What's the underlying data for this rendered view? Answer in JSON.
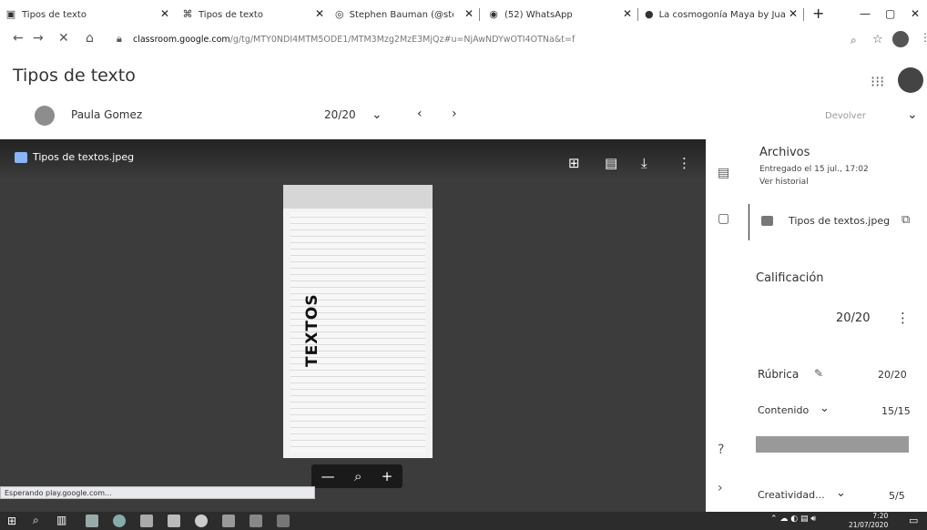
{
  "browser": {
    "tabs": [
      {
        "label": "Tipos de texto",
        "icon": "image-icon"
      },
      {
        "label": "Tipos de texto",
        "icon": "classroom-icon"
      },
      {
        "label": "Stephen Bauman (@stephen",
        "icon": "instagram-icon"
      },
      {
        "label": "(52) WhatsApp",
        "icon": "whatsapp-icon"
      },
      {
        "label": "La cosmogonía Maya by Juan",
        "icon": "prezi-icon"
      }
    ],
    "new_tab": "+",
    "url_host": "classroom.google.com",
    "url_path": "/g/tg/MTY0NDI4MTM5ODE1/MTM3Mzg2MzE3MjQz#u=NjAwNDYwOTI4OTNa&t=f",
    "window_controls": [
      "—",
      "▢",
      "✕"
    ]
  },
  "page": {
    "title": "Tipos de texto",
    "student_name": "Paula Gomez",
    "grade": "20/20",
    "status": "Devolver"
  },
  "viewer": {
    "file_name": "Tipos de textos.jpeg",
    "doc_word": "TEXTOS",
    "zoom_minus": "—",
    "zoom_plus": "+"
  },
  "status_link": "Esperando play.google.com...",
  "panel": {
    "files_heading": "Archivos",
    "delivered": "Entregado el 15 jul., 17:02",
    "history": "Ver historial",
    "file_name": "Tipos de textos.jpeg",
    "grade_heading": "Calificación",
    "grade_value": "20/20",
    "rubric_label": "Rúbrica",
    "rubric_score": "20/20",
    "criteria": [
      {
        "name": "Contenido",
        "score": "15/15"
      },
      {
        "name": "Creatividad...",
        "score": "5/5"
      }
    ]
  },
  "taskbar": {
    "time": "7:20",
    "date": "21/07/2020"
  }
}
